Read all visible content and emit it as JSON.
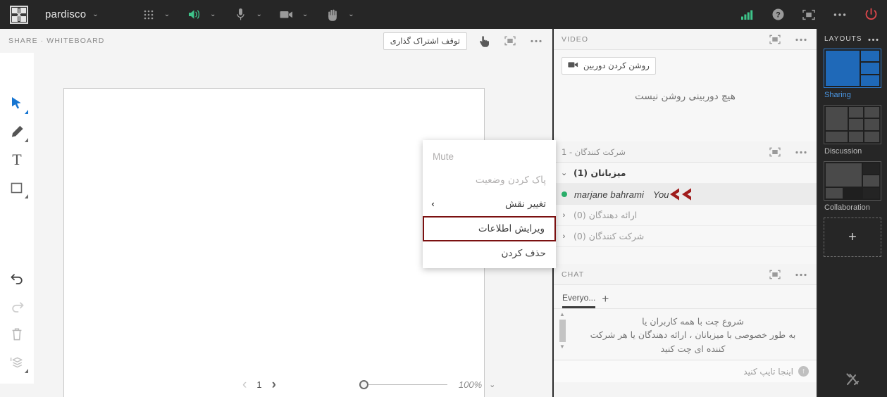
{
  "topbar": {
    "logo_icon": "grid-starburst-logo",
    "room_name": "pardisco",
    "room_chevron": "⌄",
    "controls": [
      {
        "icon": "apps-grid-icon",
        "chevron": "⌄"
      },
      {
        "icon": "speaker-icon",
        "chevron": "⌄"
      },
      {
        "icon": "microphone-icon",
        "chevron": "⌄"
      },
      {
        "icon": "camera-icon",
        "chevron": "⌄"
      },
      {
        "icon": "raise-hand-icon",
        "chevron": "⌄"
      }
    ],
    "right_icons": [
      {
        "icon": "signal-bars-icon"
      },
      {
        "icon": "help-question-icon"
      },
      {
        "icon": "fullscreen-icon"
      },
      {
        "icon": "more-options-icon"
      },
      {
        "icon": "power-leave-icon"
      }
    ],
    "accent_green": "#3ec48a",
    "accent_red": "#e0474c"
  },
  "share": {
    "header_title": "SHARE · WHITEBOARD",
    "stop_share_label": "توقف اشتراک گذاری",
    "pointer_icon": "hand-pointer-icon",
    "popout_icon": "pop-out-icon",
    "more_icon": "more-options-icon",
    "tools": [
      {
        "name": "select-tool",
        "icon": "arrow-cursor-icon",
        "active": true
      },
      {
        "name": "pencil-tool",
        "icon": "pencil-icon",
        "active": false
      },
      {
        "name": "text-tool",
        "icon": "text-T-icon",
        "active": false
      },
      {
        "name": "shape-tool",
        "icon": "rectangle-icon",
        "active": false
      }
    ],
    "bottom_tools": [
      {
        "name": "undo-tool",
        "icon": "undo-arrow-icon",
        "enabled": true
      },
      {
        "name": "redo-tool",
        "icon": "redo-arrow-icon",
        "enabled": false
      },
      {
        "name": "delete-tool",
        "icon": "trash-icon",
        "enabled": true
      },
      {
        "name": "layers-tool",
        "icon": "layers-icon",
        "enabled": true
      }
    ],
    "footer": {
      "prev_arrow": "‹",
      "page_number": "1",
      "next_arrow": "›",
      "zoom_value": "100%",
      "zoom_chevron": "⌄"
    }
  },
  "context_menu": {
    "items": [
      {
        "label": "Mute",
        "ltr": true,
        "disabled": true,
        "submenu": false,
        "highlighted": false
      },
      {
        "label": "پاک کردن وضعیت",
        "ltr": false,
        "disabled": true,
        "submenu": false,
        "highlighted": false
      },
      {
        "label": "تغییر نقش",
        "ltr": false,
        "disabled": false,
        "submenu": true,
        "highlighted": false
      },
      {
        "label": "ویرایش اطلاعات",
        "ltr": false,
        "disabled": false,
        "submenu": false,
        "highlighted": true
      },
      {
        "label": "حذف کردن",
        "ltr": false,
        "disabled": false,
        "submenu": false,
        "highlighted": false
      }
    ],
    "submenu_arrow": "›",
    "highlight_color": "#7b1010"
  },
  "video_panel": {
    "title": "VIDEO",
    "camera_button": "روشن کردن دوربین",
    "camera_icon": "camera-icon",
    "empty_message": "هیچ دوربینی روشن نیست",
    "popout_icon": "pop-out-icon",
    "more_icon": "more-options-icon"
  },
  "participants_panel": {
    "title": "شرکت کنندگان - 1",
    "popout_icon": "pop-out-icon",
    "more_icon": "more-options-icon",
    "groups": [
      {
        "label": "میزبانان (1)",
        "expanded": true,
        "twisty": "⌄"
      },
      {
        "label": "ارائه دهندگان (0)",
        "expanded": false,
        "twisty": "›"
      },
      {
        "label": "شرکت کنندگان (0)",
        "expanded": false,
        "twisty": "›"
      }
    ],
    "person": {
      "name": "marjane bahrami",
      "you_label": "You",
      "status_color": "#2aae6a",
      "annotation_icon": "double-chevron-left-annotation",
      "annotation_color": "#a01c1c"
    }
  },
  "chat_panel": {
    "title": "CHAT",
    "popout_icon": "pop-out-icon",
    "more_icon": "more-options-icon",
    "tab_label": "Everyo...",
    "add_tab": "+",
    "hint_line1": "شروع چت با همه کاربران یا",
    "hint_line2": "به طور خصوصی با میزبانان ، ارائه دهندگان یا هر شرکت",
    "hint_line3": "کننده ای چت کنید",
    "input_placeholder": "اینجا تایپ کنید",
    "info_icon": "info-circle-icon"
  },
  "layouts_panel": {
    "title": "LAYOUTS",
    "more_icon": "more-options-icon",
    "items": [
      {
        "label": "Sharing",
        "selected": true
      },
      {
        "label": "Discussion",
        "selected": false
      },
      {
        "label": "Collaboration",
        "selected": false
      }
    ],
    "add_label": "+",
    "selected_color": "#4a96e2",
    "tools_icon": "hammer-wrench-icon"
  }
}
